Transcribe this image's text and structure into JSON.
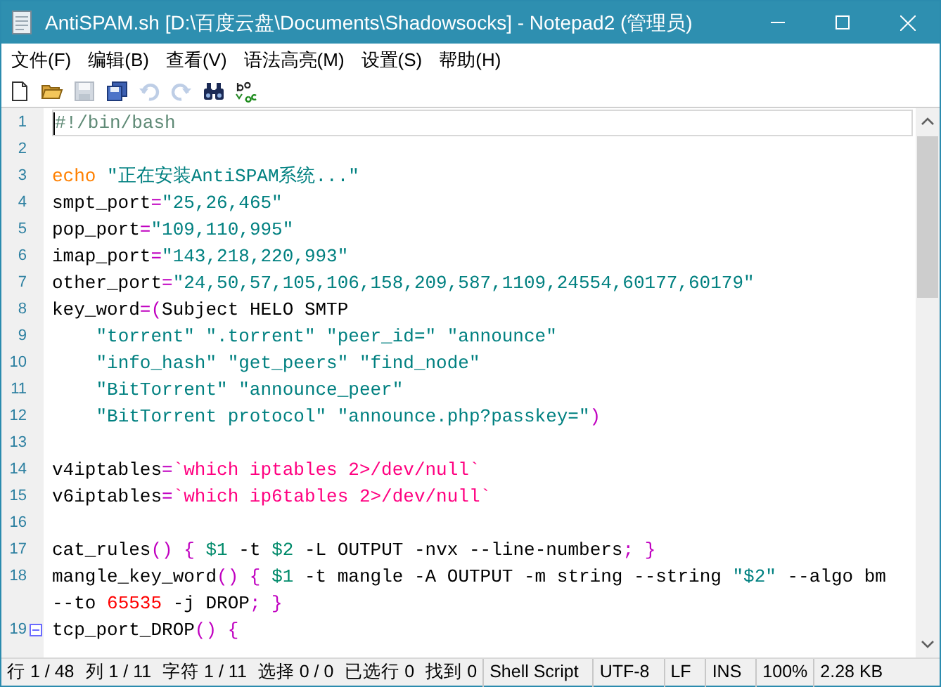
{
  "window": {
    "title": "AntiSPAM.sh [D:\\百度云盘\\Documents\\Shadowsocks] - Notepad2 (管理员)"
  },
  "menu": [
    "文件(F)",
    "编辑(B)",
    "查看(V)",
    "语法高亮(M)",
    "设置(S)",
    "帮助(H)"
  ],
  "toolbar": [
    {
      "kind": "new",
      "disabled": false
    },
    {
      "kind": "open",
      "disabled": false
    },
    {
      "kind": "save",
      "disabled": true
    },
    {
      "kind": "save_all",
      "disabled": false
    },
    {
      "kind": "undo",
      "disabled": true
    },
    {
      "kind": "redo",
      "disabled": true
    },
    {
      "kind": "find",
      "disabled": false
    },
    {
      "kind": "replace",
      "disabled": false
    }
  ],
  "lines": [
    {
      "number": "1",
      "current": true,
      "fold_start": false,
      "rows": [
        [
          {
            "kind": "comment",
            "text": "#!/bin/bash"
          }
        ]
      ]
    },
    {
      "number": "2",
      "current": false,
      "fold_start": false,
      "rows": [
        []
      ]
    },
    {
      "number": "3",
      "current": false,
      "fold_start": false,
      "rows": [
        [
          {
            "kind": "keyword",
            "text": "echo"
          },
          {
            "kind": "plain",
            "text": " "
          },
          {
            "kind": "string",
            "text": "\"正在安装AntiSPAM系统...\""
          }
        ]
      ]
    },
    {
      "number": "4",
      "current": false,
      "fold_start": false,
      "rows": [
        [
          {
            "kind": "plain",
            "text": "smpt_port"
          },
          {
            "kind": "operator",
            "text": "="
          },
          {
            "kind": "string",
            "text": "\"25,26,465\""
          }
        ]
      ]
    },
    {
      "number": "5",
      "current": false,
      "fold_start": false,
      "rows": [
        [
          {
            "kind": "plain",
            "text": "pop_port"
          },
          {
            "kind": "operator",
            "text": "="
          },
          {
            "kind": "string",
            "text": "\"109,110,995\""
          }
        ]
      ]
    },
    {
      "number": "6",
      "current": false,
      "fold_start": false,
      "rows": [
        [
          {
            "kind": "plain",
            "text": "imap_port"
          },
          {
            "kind": "operator",
            "text": "="
          },
          {
            "kind": "string",
            "text": "\"143,218,220,993\""
          }
        ]
      ]
    },
    {
      "number": "7",
      "current": false,
      "fold_start": false,
      "rows": [
        [
          {
            "kind": "plain",
            "text": "other_port"
          },
          {
            "kind": "operator",
            "text": "="
          },
          {
            "kind": "string",
            "text": "\"24,50,57,105,106,158,209,587,1109,24554,60177,60179\""
          }
        ]
      ]
    },
    {
      "number": "8",
      "current": false,
      "fold_start": false,
      "rows": [
        [
          {
            "kind": "plain",
            "text": "key_word"
          },
          {
            "kind": "operator",
            "text": "=("
          },
          {
            "kind": "plain",
            "text": "Subject HELO SMTP"
          }
        ]
      ]
    },
    {
      "number": "9",
      "current": false,
      "fold_start": false,
      "rows": [
        [
          {
            "kind": "plain",
            "text": "    "
          },
          {
            "kind": "string",
            "text": "\"torrent\" \".torrent\" \"peer_id=\" \"announce\""
          }
        ]
      ]
    },
    {
      "number": "10",
      "current": false,
      "fold_start": false,
      "rows": [
        [
          {
            "kind": "plain",
            "text": "    "
          },
          {
            "kind": "string",
            "text": "\"info_hash\" \"get_peers\" \"find_node\""
          }
        ]
      ]
    },
    {
      "number": "11",
      "current": false,
      "fold_start": false,
      "rows": [
        [
          {
            "kind": "plain",
            "text": "    "
          },
          {
            "kind": "string",
            "text": "\"BitTorrent\" \"announce_peer\""
          }
        ]
      ]
    },
    {
      "number": "12",
      "current": false,
      "fold_start": false,
      "rows": [
        [
          {
            "kind": "plain",
            "text": "    "
          },
          {
            "kind": "string",
            "text": "\"BitTorrent protocol\" \"announce.php?passkey=\""
          },
          {
            "kind": "operator",
            "text": ")"
          }
        ]
      ]
    },
    {
      "number": "13",
      "current": false,
      "fold_start": false,
      "rows": [
        []
      ]
    },
    {
      "number": "14",
      "current": false,
      "fold_start": false,
      "rows": [
        [
          {
            "kind": "plain",
            "text": "v4iptables"
          },
          {
            "kind": "operator",
            "text": "="
          },
          {
            "kind": "backtick",
            "text": "`which iptables 2>/dev/null`"
          }
        ]
      ]
    },
    {
      "number": "15",
      "current": false,
      "fold_start": false,
      "rows": [
        [
          {
            "kind": "plain",
            "text": "v6iptables"
          },
          {
            "kind": "operator",
            "text": "="
          },
          {
            "kind": "backtick",
            "text": "`which ip6tables 2>/dev/null`"
          }
        ]
      ]
    },
    {
      "number": "16",
      "current": false,
      "fold_start": false,
      "rows": [
        []
      ]
    },
    {
      "number": "17",
      "current": false,
      "fold_start": false,
      "rows": [
        [
          {
            "kind": "plain",
            "text": "cat_rules"
          },
          {
            "kind": "operator",
            "text": "() {"
          },
          {
            "kind": "plain",
            "text": " "
          },
          {
            "kind": "variable",
            "text": "$1"
          },
          {
            "kind": "plain",
            "text": " -t "
          },
          {
            "kind": "variable",
            "text": "$2"
          },
          {
            "kind": "plain",
            "text": " -L OUTPUT -nvx --line-numbers"
          },
          {
            "kind": "operator",
            "text": "; }"
          }
        ]
      ]
    },
    {
      "number": "18",
      "current": false,
      "fold_start": false,
      "rows": [
        [
          {
            "kind": "plain",
            "text": "mangle_key_word"
          },
          {
            "kind": "operator",
            "text": "() {"
          },
          {
            "kind": "plain",
            "text": " "
          },
          {
            "kind": "variable",
            "text": "$1"
          },
          {
            "kind": "plain",
            "text": " -t mangle -A OUTPUT -m string --string "
          },
          {
            "kind": "string",
            "text": "\"$2\""
          },
          {
            "kind": "plain",
            "text": " --algo bm"
          }
        ]
      ],
      "wrapped": [
        {
          "kind": "plain",
          "text": "--to "
        },
        {
          "kind": "number",
          "text": "65535"
        },
        {
          "kind": "plain",
          "text": " -j DROP"
        },
        {
          "kind": "operator",
          "text": "; }"
        }
      ]
    },
    {
      "number": "19",
      "current": false,
      "fold_start": true,
      "rows": [
        [
          {
            "kind": "plain",
            "text": "tcp_port_DROP"
          },
          {
            "kind": "operator",
            "text": "() {"
          }
        ]
      ]
    }
  ],
  "status_bar": [
    "行 1 / 48",
    "列 1 / 11",
    "字符 1 / 11",
    "选择 0 / 0",
    "已选行 0",
    "找到 0",
    "Shell Script",
    "UTF-8",
    "LF",
    "INS",
    "100%",
    "2.28 KB"
  ]
}
